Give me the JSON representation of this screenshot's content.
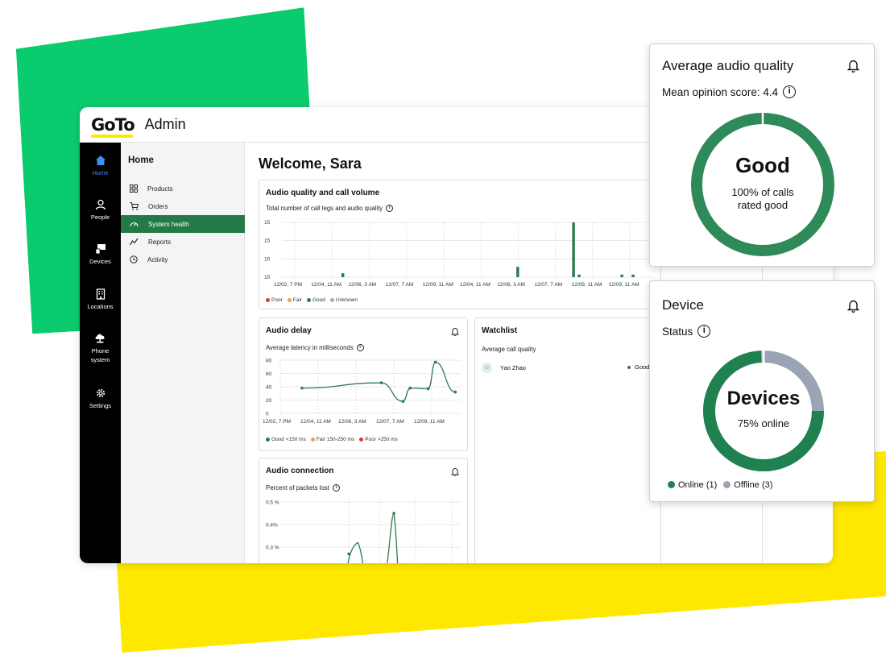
{
  "app": {
    "logo": "GoTo",
    "name": "Admin"
  },
  "rail": [
    {
      "label": "Home",
      "icon": "home-icon"
    },
    {
      "label": "People",
      "icon": "person-icon"
    },
    {
      "label": "Devices",
      "icon": "devices-icon"
    },
    {
      "label": "Locations",
      "icon": "building-icon"
    },
    {
      "label_line1": "Phone",
      "label_line2": "system",
      "icon": "phone-system-icon"
    },
    {
      "label": "Settings",
      "icon": "gear-icon"
    }
  ],
  "subnav": {
    "title": "Home",
    "items": [
      {
        "label": "Products",
        "icon": "grid-icon"
      },
      {
        "label": "Orders",
        "icon": "cart-icon"
      },
      {
        "label": "System health",
        "icon": "gauge-icon",
        "active": true
      },
      {
        "label": "Reports",
        "icon": "trend-icon"
      },
      {
        "label": "Activity",
        "icon": "history-icon"
      }
    ]
  },
  "welcome": "Welcome, Sara",
  "audio_quality_card": {
    "title": "Audio quality and call volume",
    "subtitle": "Total number of call legs and audio quality",
    "legend": [
      "Poor",
      "Fair",
      "Good",
      "Unknown"
    ],
    "legend_colors": [
      "#d93a3a",
      "#f0a04b",
      "#2e7d4f",
      "#a9a9a9"
    ]
  },
  "audio_delay_card": {
    "title": "Audio delay",
    "subtitle": "Average latency in milliseconds",
    "legend": [
      "Good <150 ms",
      "Fair 150-250 ms",
      "Poor >250 ms"
    ],
    "legend_colors": [
      "#2e7d4f",
      "#f0a04b",
      "#d93a3a"
    ]
  },
  "watchlist_card": {
    "title": "Watchlist",
    "subtitle": "Average call quality",
    "rows": [
      {
        "name": "Yao Zhao",
        "status": "Good"
      }
    ]
  },
  "audio_connection_card": {
    "title": "Audio connection",
    "subtitle": "Percent of packets lost"
  },
  "avg_audio_popup": {
    "title": "Average audio quality",
    "subtitle": "Mean opinion score: 4.4",
    "center_label": "Good",
    "center_sub_line1": "100% of calls",
    "center_sub_line2": "rated good",
    "good_fraction": 1.0,
    "color": "#2e8a58"
  },
  "device_popup": {
    "title": "Device",
    "subtitle": "Status",
    "center_label": "Devices",
    "center_sub": "75% online",
    "online_fraction": 0.75,
    "legend": [
      {
        "label": "Online (1)",
        "color": "#1f8150"
      },
      {
        "label": "Offline (3)",
        "color": "#9aa4b5"
      }
    ]
  },
  "chart_data": [
    {
      "type": "bar",
      "title": "Audio quality and call volume",
      "subtitle": "Total number of call legs and audio quality",
      "y_tick_labels": [
        "15",
        "15",
        "15",
        "15"
      ],
      "x_tick_labels": [
        "12/02, 7 PM",
        "12/04, 11 AM",
        "12/06, 3 AM",
        "12/07, 7 AM",
        "12/09, 11 AM",
        "12/04, 11 AM",
        "12/06, 3 AM",
        "12/07, 7 AM",
        "12/09, 11 AM",
        "12/09, 11 AM"
      ],
      "series": [
        {
          "name": "Good",
          "values": [
            0,
            0.6,
            0,
            0,
            0,
            1.6,
            0,
            8.4,
            0.4,
            0.4,
            0.4
          ]
        }
      ],
      "ylim": [
        0,
        8.4
      ],
      "grid": true
    },
    {
      "type": "line",
      "title": "Audio delay",
      "subtitle": "Average latency in milliseconds",
      "y_ticks": [
        0,
        20,
        40,
        60,
        80
      ],
      "x_tick_labels": [
        "12/02, 7 PM",
        "12/04, 11 AM",
        "12/06, 3 AM",
        "12/07, 7 AM",
        "12/09, 11 AM"
      ],
      "x_positions": [
        0.12,
        0.56,
        0.68,
        0.72,
        0.82,
        0.86,
        0.97
      ],
      "values": [
        38,
        46,
        18,
        38,
        37,
        77,
        32
      ],
      "ylim": [
        0,
        80
      ],
      "grid": true
    },
    {
      "type": "line",
      "title": "Audio connection",
      "subtitle": "Percent of packets lost",
      "y_tick_labels": [
        "0.5 %",
        "0.4%",
        "0.3 %"
      ],
      "x_positions": [
        0.38,
        0.43,
        0.63
      ],
      "values": [
        0.27,
        0.32,
        0.45
      ],
      "grid": true
    }
  ]
}
